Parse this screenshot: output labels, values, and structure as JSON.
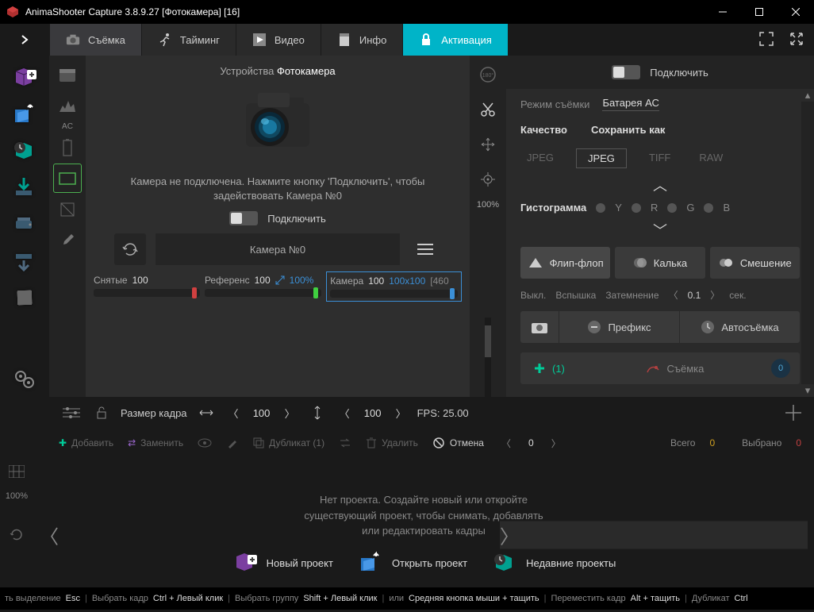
{
  "title": "AnimaShooter Capture 3.8.9.27 [Фотокамера] [16]",
  "tabs": {
    "shoot": "Съёмка",
    "timing": "Тайминг",
    "video": "Видео",
    "info": "Инфо",
    "activation": "Активация"
  },
  "device": {
    "label": "Устройства",
    "name": "Фотокамера",
    "message": "Камера не подключена. Нажмите кнопку 'Подключить', чтобы задействовать Камера №0",
    "connect": "Подключить",
    "camera_select": "Камера №0"
  },
  "tool": {
    "ac": "AC"
  },
  "sliders": {
    "shot_label": "Снятые",
    "shot_val": "100",
    "ref_label": "Референс",
    "ref_val": "100",
    "ref_pct": "100%",
    "cam_label": "Камера",
    "cam_val": "100",
    "cam_dim": "100x100",
    "cam_extra": "[460"
  },
  "mid": {
    "pct": "100%"
  },
  "right": {
    "connect": "Подключить",
    "mode_label": "Режим съёмки",
    "battery": "Батарея АС",
    "quality": "Качество",
    "save_as": "Сохранить как",
    "fmt_jpeg": "JPEG",
    "fmt_jpeg2": "JPEG",
    "fmt_tiff": "TIFF",
    "fmt_raw": "RAW",
    "histogram": "Гистограмма",
    "ch_y": "Y",
    "ch_r": "R",
    "ch_g": "G",
    "ch_b": "B",
    "flip": "Флип-флоп",
    "onion": "Калька",
    "blend": "Смешение",
    "off": "Выкл.",
    "flash": "Вспышка",
    "dimming": "Затемнение",
    "dim_val": "0.1",
    "sec": "сек.",
    "prefix": "Префикс",
    "auto": "Автосъёмка",
    "plus_count": "(1)",
    "shoot": "Съёмка",
    "shoot_count": "0"
  },
  "framesize": {
    "label": "Размер кадра",
    "w": "100",
    "h": "100",
    "fps": "FPS: 25.00"
  },
  "actions": {
    "add": "Добавить",
    "replace": "Заменить",
    "duplicate": "Дубликат (1)",
    "delete": "Удалить",
    "cancel": "Отмена",
    "count": "0",
    "total_lbl": "Всего",
    "total": "0",
    "selected_lbl": "Выбрано",
    "selected": "0"
  },
  "timeline": {
    "pct": "100%",
    "msg1": "Нет проекта. Создайте новый или откройте",
    "msg2": "существующий проект, чтобы снимать, добавлять",
    "msg3": "или редактировать кадры",
    "new": "Новый проект",
    "open": "Открыть проект",
    "recent": "Недавние проекты"
  },
  "status": {
    "s1a": "ть выделение",
    "s1b": "Esc",
    "s2a": "Выбрать кадр",
    "s2b": "Ctrl + Левый клик",
    "s3a": "Выбрать группу",
    "s3b": "Shift + Левый клик",
    "s4a": "или",
    "s4b": "Средняя кнопка мыши + тащить",
    "s5a": "Переместить кадр",
    "s5b": "Alt + тащить",
    "s6a": "Дубликат",
    "s6b": "Ctrl"
  }
}
